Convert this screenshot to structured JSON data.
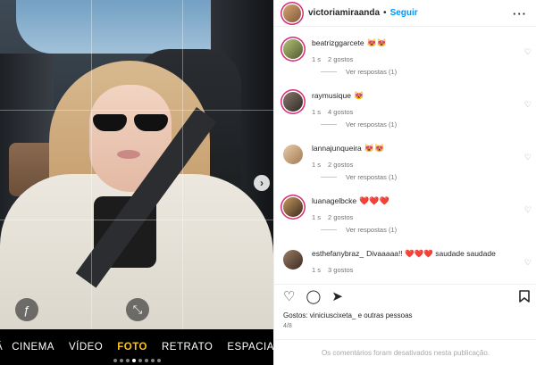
{
  "post": {
    "author": "victoriamiraanda",
    "separator": "•",
    "follow_label": "Seguir",
    "more_icon": "more-horizontal-icon",
    "pager": "4/8",
    "likes_text": "Gostos: viniciuscixeta_ e outras pessoas",
    "comments_disabled": "Os comentários foram desativados nesta publicação."
  },
  "camera": {
    "modes": [
      "ÇÃ",
      "CINEMA",
      "VÍDEO",
      "FOTO",
      "RETRATO",
      "ESPACIAL"
    ],
    "active_mode": "FOTO",
    "flash_icon": "ƒ",
    "collapse_icon": "⤡",
    "next_icon": "›"
  },
  "comments": [
    {
      "user": "beatrizggarcete",
      "text": "😻😻",
      "time": "1 s",
      "likes": "2 gostos",
      "replies": "Ver respostas (1)",
      "story_ring": true
    },
    {
      "user": "raymusique",
      "text": "😻",
      "time": "1 s",
      "likes": "4 gostos",
      "replies": "Ver respostas (1)",
      "story_ring": true
    },
    {
      "user": "lannajunqueira",
      "text": "😻😻",
      "time": "1 s",
      "likes": "2 gostos",
      "replies": "Ver respostas (1)",
      "story_ring": false
    },
    {
      "user": "luanagelbcke",
      "text": "❤️❤️❤️",
      "time": "1 s",
      "likes": "2 gostos",
      "replies": "Ver respostas (1)",
      "story_ring": true
    },
    {
      "user": "esthefanybraz_",
      "text": "Divaaaaa!! ❤️❤️❤️ saudade saudade",
      "time": "1 s",
      "likes": "3 gostos",
      "replies": "",
      "story_ring": false
    }
  ],
  "actions": {
    "like_icon": "♡",
    "comment_icon": "◯",
    "share_icon": "➤",
    "save_icon": "🔖"
  },
  "colors": {
    "accent": "#0095f6",
    "camera_active": "#f6c223",
    "ring": "#d62976"
  }
}
